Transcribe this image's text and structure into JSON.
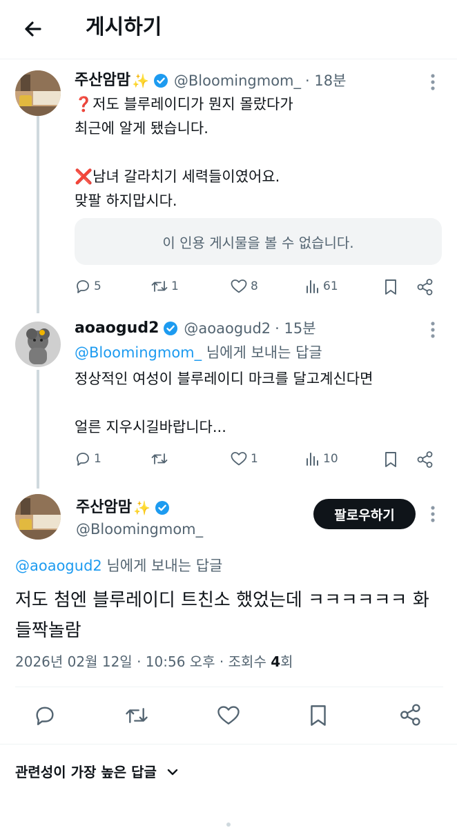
{
  "header": {
    "title": "게시하기"
  },
  "thread": [
    {
      "display_name": "주산암맘",
      "emoji": "✨",
      "handle": "@Bloomingmom_",
      "time": "· 18분",
      "text_lines": [
        "❓저도 블루레이디가 뭔지 몰랐다가",
        "최근에 알게 됐습니다.",
        "",
        "❌남녀 갈라치기 세력들이였어요.",
        "맞팔 하지맙시다."
      ],
      "quote_unavailable": "이 인용 게시물을 볼 수 없습니다.",
      "counts": {
        "replies": "5",
        "reposts": "1",
        "likes": "8",
        "views": "61"
      }
    },
    {
      "display_name": "aoaogud2",
      "handle": "@aoaogud2",
      "time": "· 15분",
      "reply_to_handle": "@Bloomingmom_",
      "reply_to_suffix": " 님에게 보내는 답글",
      "text_lines": [
        "정상적인 여성이 블루레이디 마크를 달고계신다면",
        "",
        "얼른 지우시길바랍니다..."
      ],
      "counts": {
        "replies": "1",
        "reposts": "",
        "likes": "1",
        "views": "10"
      }
    }
  ],
  "main_post": {
    "display_name": "주산암맘",
    "emoji": "✨",
    "handle": "@Bloomingmom_",
    "follow_label": "팔로우하기",
    "reply_to_handle": "@aoaogud2",
    "reply_to_suffix": " 님에게 보내는 답글",
    "text": "저도 첨엔 블루레이디 트친소 했었는데 ㅋㅋㅋㅋㅋㅋ 화들짝놀람",
    "date": "2026년 02월 12일 · 10:56 오후 · 조회수 ",
    "views": "4",
    "views_suffix": "회"
  },
  "replies_sort": {
    "label": "관련성이 가장 높은 답글"
  },
  "colors": {
    "accent": "#1d9bf0",
    "text": "#0f1419",
    "muted": "#536471",
    "button_dark": "#0f1419"
  }
}
